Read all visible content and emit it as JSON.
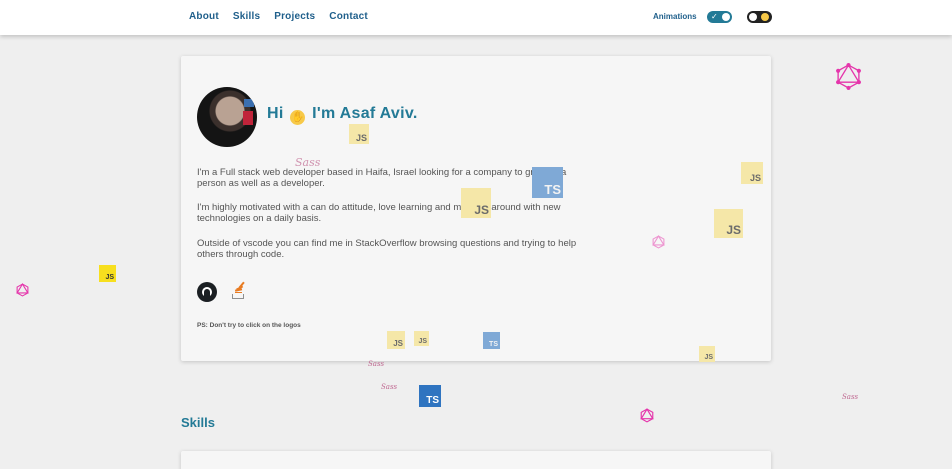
{
  "nav": {
    "items": [
      "About",
      "Skills",
      "Projects",
      "Contact"
    ],
    "animations_label": "Animations",
    "animations_on": true,
    "dark_mode_on": false
  },
  "hero": {
    "greeting_prefix": "Hi",
    "greeting_emoji": "waving-hand",
    "greeting_suffix": "I'm Asaf Aviv.",
    "paragraphs": [
      "I'm a Full stack web developer based in Haifa, Israel looking for a company to grow as a person as well as a developer.",
      "I'm highly motivated with a can do attitude, love learning and messing around with new technologies on a daily basis.",
      "Outside of vscode you can find me in StackOverflow browsing questions and trying to help others through code."
    ],
    "social": [
      "github-icon",
      "stackoverflow-icon"
    ],
    "ps": "PS: Don't try to click on the logos"
  },
  "skills": {
    "heading": "Skills"
  },
  "floating_logos": {
    "js_label": "JS",
    "ts_label": "TS",
    "sass_label": "Sass",
    "colors": {
      "js": "#f7df1e",
      "ts": "#2f74c0",
      "graphql": "#e535ab",
      "sass": "#c06a92",
      "accent": "#237a96"
    }
  }
}
